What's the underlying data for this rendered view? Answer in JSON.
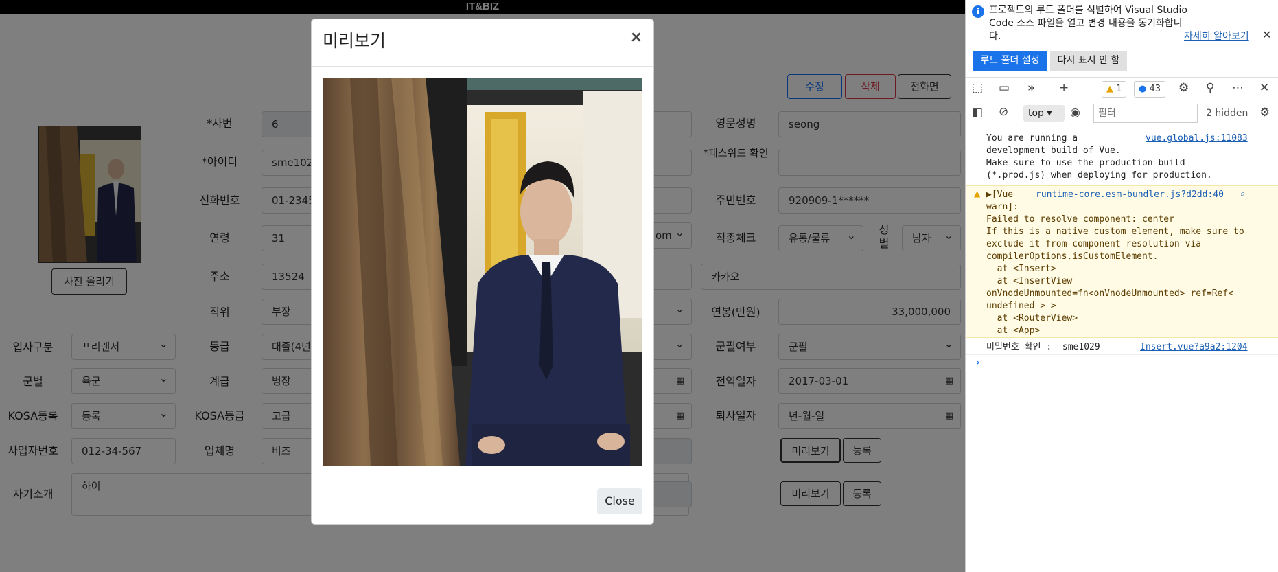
{
  "app": {
    "brand": "IT&BIZ",
    "buttons": {
      "edit": "수정",
      "delete": "삭제",
      "back": "전화면",
      "upload_photo": "사진 올리기",
      "preview1": "미리보기",
      "register1": "등록",
      "preview2": "미리보기",
      "register2": "등록"
    },
    "colors": {
      "edit_blue": "#0d6efd",
      "delete_red": "#dc3545"
    },
    "fields": {
      "emp_no_label": "*사번",
      "emp_no": "6",
      "id_label": "*아이디",
      "id": "sme1029",
      "phone_label": "전화번호",
      "phone": "01-2345",
      "age_label": "연령",
      "age": "31",
      "address_label": "주소",
      "address": "13524",
      "position_label": "직위",
      "position": "부장",
      "grade_label": "등급",
      "grade": "대졸(4년",
      "rank_label": "계급",
      "rank": "병장",
      "kosa_grade_label": "KOSA등급",
      "kosa_grade": "고급",
      "company_label": "업체명",
      "company": "비즈",
      "join_type_label": "입사구분",
      "join_type": "프리랜서",
      "military_type_label": "군별",
      "military_type": "육군",
      "kosa_reg_label": "KOSA등록",
      "kosa_reg": "등록",
      "biz_no_label": "사업자번호",
      "biz_no": "012-34-567",
      "intro_label": "자기소개",
      "intro": "하이",
      "email_domain": "om",
      "eng_name_label": "영문성명",
      "eng_name": "seong",
      "pw_confirm_label": "*패스워드 확인",
      "pw_confirm": "",
      "ssn_label": "주민번호",
      "ssn": "920909-1******",
      "job_check_label": "직종체크",
      "job_check": "유통/물류",
      "gender_label": "성별",
      "gender": "남자",
      "address_detail": "카카오",
      "salary_label": "연봉(만원)",
      "salary": "33,000,000",
      "military_status_label": "군필여부",
      "military_status": "군필",
      "discharge_date_label": "전역일자",
      "discharge_date": "2017-03-01",
      "resign_date_label": "퇴사일자",
      "resign_date": "년-월-일"
    }
  },
  "modal": {
    "title": "미리보기",
    "close_x": "×",
    "close_button": "Close"
  },
  "devtools": {
    "info_text": "프로젝트의 루트 폴더를 식별하여 Visual Studio Code 소스 파일을 열고 변경 내용을 동기화합니다.",
    "learn_more": "자세히 알아보기",
    "info_close": "✕",
    "set_root_button": "루트 폴더 설정",
    "dont_show_button": "다시 표시 안 함",
    "warn_count": "1",
    "msg_count": "43",
    "context": "top",
    "filter_placeholder": "필터",
    "hidden_count": "2 hidden",
    "console": {
      "line1": "You are running a",
      "line1_link": "vue.global.js:11083",
      "line2": "development build of Vue.",
      "line3": "Make sure to use the production build",
      "line4": "(*.prod.js) when deploying for production.",
      "warn_head": "▶[Vue",
      "warn_link": "runtime-core.esm-bundler.js?d2dd:40",
      "warn_lines": [
        "warn]:",
        "Failed to resolve component: center",
        "If this is a native custom element, make sure to",
        "exclude it from component resolution via",
        "compilerOptions.isCustomElement.",
        "  at <Insert>",
        "  at <InsertView",
        "onVnodeUnmounted=fn<onVnodeUnmounted> ref=Ref<",
        "undefined > >",
        "  at <RouterView>",
        "  at <App>"
      ],
      "log_text": "비밀번호 확인 :  sme1029",
      "log_link": "Insert.vue?a9a2:1204",
      "prompt": "›"
    }
  }
}
